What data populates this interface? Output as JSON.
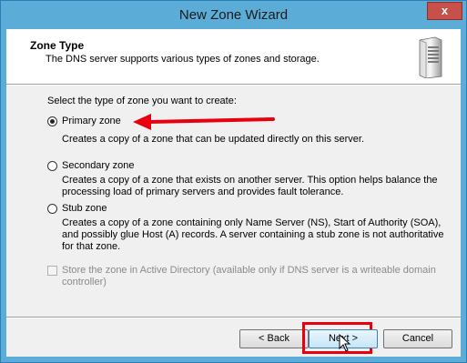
{
  "window": {
    "title": "New Zone Wizard",
    "close_glyph": "x"
  },
  "header": {
    "title": "Zone Type",
    "subtitle": "The DNS server supports various types of zones and storage.",
    "icon": "server-icon"
  },
  "prompt": "Select the type of zone you want to create:",
  "zone_options": [
    {
      "label": "Primary zone",
      "selected": true,
      "description": "Creates a copy of a zone that can be updated directly on this server."
    },
    {
      "label": "Secondary zone",
      "selected": false,
      "description": "Creates a copy of a zone that exists on another server. This option helps balance the processing load of primary servers and provides fault tolerance."
    },
    {
      "label": "Stub zone",
      "selected": false,
      "description": "Creates a copy of a zone containing only Name Server (NS), Start of Authority (SOA), and possibly glue Host (A) records. A server containing a stub zone is not authoritative for that zone."
    }
  ],
  "ad_store": {
    "label": "Store the zone in Active Directory (available only if DNS server is a writeable domain controller)",
    "checked": false,
    "enabled": false
  },
  "buttons": {
    "back": "< Back",
    "next": "Next >",
    "cancel": "Cancel"
  },
  "annotations": {
    "arrow_color": "#e8000f",
    "highlight_color": "#e8000f"
  }
}
